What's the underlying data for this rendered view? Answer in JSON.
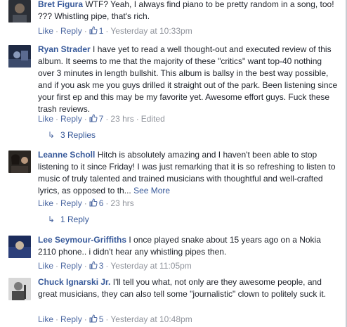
{
  "actions": {
    "like": "Like",
    "reply": "Reply",
    "dot": "·"
  },
  "comments": [
    {
      "name": "Bret Figura",
      "text": "WTF? Yeah, I always find piano to be pretty random in a song, too! ??? Whistling pipe, that's rich.",
      "likes": "1",
      "time": "Yesterday at 10:33pm",
      "edited": ""
    },
    {
      "name": "Ryan Strader",
      "text": "I have yet to read a well thought-out and executed review of this album. It seems to me that the majority of these \"critics\" want top-40 nothing over 3 minutes in length bullshit. This album is ballsy in the best way possible, and if you ask me you guys drilled it straight out of the park. Been listening since your first ep and this may be my favorite yet. Awesome effort guys. Fuck these trash reviews.",
      "likes": "7",
      "time": "23 hrs",
      "edited": "Edited",
      "replies": "3 Replies"
    },
    {
      "name": "Leanne Scholl",
      "text": "Hitch is absolutely amazing and I haven't been able to stop listening to it since Friday! I was just remarking that it is so refreshing to listen to music of truly talented and trained musicians with thoughtful and well-crafted lyrics, as opposed to th...",
      "see_more": "See More",
      "likes": "6",
      "time": "23 hrs",
      "edited": "",
      "replies": "1 Reply"
    },
    {
      "name": "Lee Seymour-Griffiths",
      "text": "I once played snake about 15 years ago on a Nokia 2110 phone.. i didn't hear any whistling pipes then.",
      "likes": "3",
      "time": "Yesterday at 11:05pm",
      "edited": ""
    },
    {
      "name": "Chuck Ignarski Jr.",
      "text": "I'll tell you what, not only are they awesome people, and great musicians, they can also tell some \"journalistic\" clown to politely suck it.",
      "likes": "5",
      "time": "Yesterday at 10:48pm",
      "edited": ""
    }
  ]
}
